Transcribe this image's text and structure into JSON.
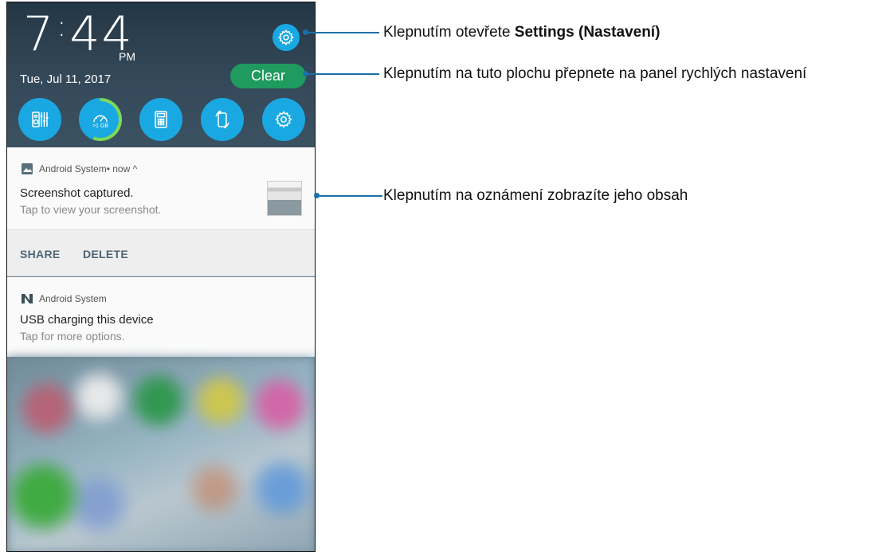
{
  "status": {
    "time_hours": "7",
    "time_minutes": "44",
    "ampm": "PM",
    "date": "Tue, Jul 11, 2017"
  },
  "header": {
    "clear_label": "Clear",
    "settings_icon": "gear-icon"
  },
  "quick_settings": [
    {
      "name": "audio-wizard",
      "icon": "equalizer-icon"
    },
    {
      "name": "boost",
      "icon": "speedometer-icon",
      "label": ">1 GB"
    },
    {
      "name": "calculator",
      "icon": "calculator-icon"
    },
    {
      "name": "auto-rotate",
      "icon": "rotate-icon"
    },
    {
      "name": "settings",
      "icon": "gear-icon"
    }
  ],
  "notifications": [
    {
      "app": "Android System",
      "meta": " • now ^",
      "title": "Screenshot captured.",
      "text": "Tap to view your screenshot.",
      "actions": [
        "SHARE",
        "DELETE"
      ]
    },
    {
      "app": "Android System",
      "title": "USB charging this device",
      "text": "Tap for more options."
    }
  ],
  "callouts": {
    "settings_prefix": "Klepnutím otevřete ",
    "settings_bold": "Settings (Nastavení)",
    "quick_panel": "Klepnutím na tuto plochu přepnete na panel rychlých nastavení",
    "notification": "Klepnutím na oznámení zobrazíte jeho obsah"
  },
  "colors": {
    "accent": "#1aa8e2",
    "clear_button": "#1f9b5f",
    "callout_line": "#1b6fa8"
  }
}
